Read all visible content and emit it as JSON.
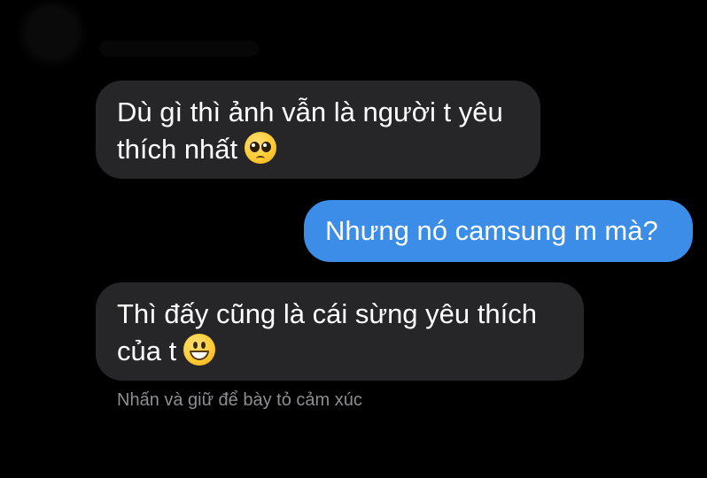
{
  "messages": [
    {
      "direction": "incoming",
      "line1": "Dù gì thì ảnh vẫn là người t yêu",
      "line2": "thích nhất",
      "emoji": "pleading-face-icon"
    },
    {
      "direction": "outgoing",
      "text": "Nhưng nó camsung m mà?"
    },
    {
      "direction": "incoming",
      "line1": "Thì đấy cũng là cái sừng yêu thích",
      "line2": "của t",
      "emoji": "grinning-face-icon"
    }
  ],
  "reaction_hint": "Nhấn và giữ để bày tỏ cảm xúc",
  "colors": {
    "background": "#000000",
    "incoming_bubble": "#262628",
    "outgoing_bubble": "#3c8de8",
    "hint_text": "#8e8e93"
  }
}
